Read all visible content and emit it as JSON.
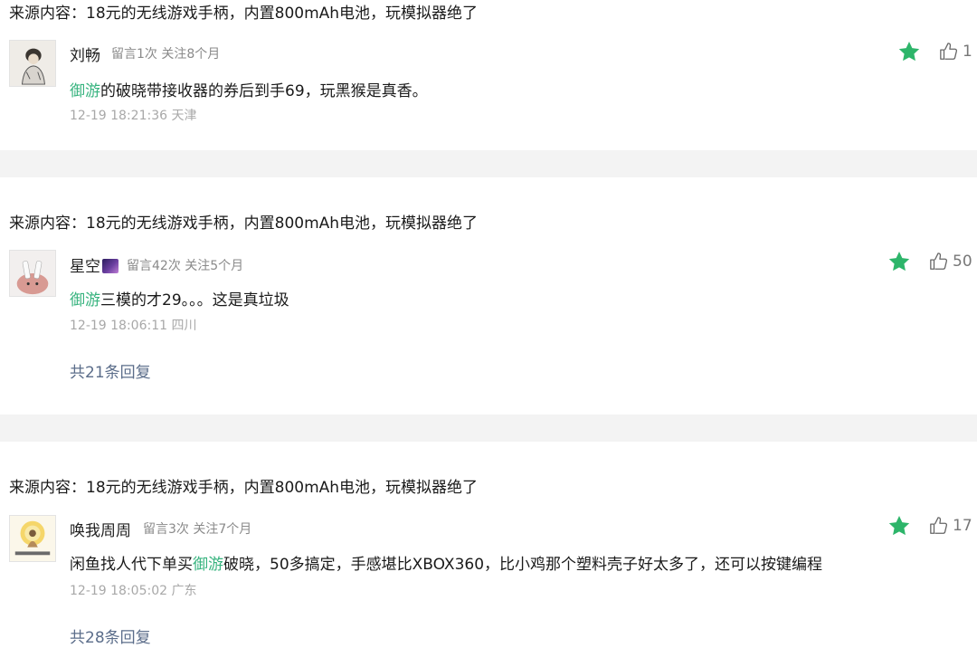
{
  "comments": [
    {
      "source": "来源内容：18元的无线游戏手柄，内置800mAh电池，玩模拟器绝了",
      "username": "刘畅",
      "stats": "留言1次 关注8个月",
      "text_pre": "",
      "keyword": "御游",
      "text_post": "的破晓带接收器的券后到手69，玩黑猴是真香。",
      "time_location": "12-19 18:21:36 天津",
      "likes": "1",
      "star_color": "#2db56a"
    },
    {
      "source": "来源内容：18元的无线游戏手柄，内置800mAh电池，玩模拟器绝了",
      "username": "星空",
      "username_emoji": "galaxy-emoji",
      "stats": "留言42次 关注5个月",
      "text_pre": "",
      "keyword": "御游",
      "text_post": "三模的才29。。。这是真垃圾",
      "time_location": "12-19 18:06:11 四川",
      "replies": "共21条回复",
      "likes": "50",
      "star_color": "#2db56a"
    },
    {
      "source": "来源内容：18元的无线游戏手柄，内置800mAh电池，玩模拟器绝了",
      "username": "唤我周周",
      "stats": "留言3次 关注7个月",
      "text_pre": "闲鱼找人代下单买",
      "keyword": "御游",
      "text_post": "破晓，50多搞定，手感堪比XBOX360，比小鸡那个塑料壳子好太多了，还可以按键编程",
      "time_location": "12-19 18:05:02 广东",
      "replies": "共28条回复",
      "likes": "17",
      "star_color": "#2db56a"
    }
  ]
}
